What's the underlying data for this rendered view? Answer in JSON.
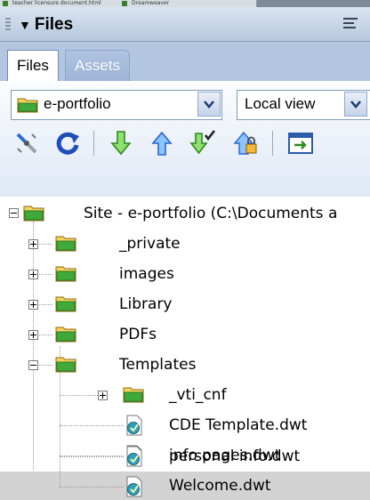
{
  "taskbar": {
    "items": [
      "teacher licensure document.html",
      "Dreamweaver"
    ]
  },
  "panel": {
    "title": "Files",
    "options_icon": "options-menu-icon"
  },
  "tabs": [
    {
      "label": "Files",
      "active": true
    },
    {
      "label": "Assets",
      "active": false
    }
  ],
  "site_select": {
    "value": "e-portfolio",
    "icon": "site-folder-icon"
  },
  "view_select": {
    "value": "Local view"
  },
  "toolbar_icons": [
    "connect-icon",
    "refresh-icon",
    "get-files-icon",
    "put-files-icon",
    "check-out-icon",
    "check-in-icon",
    "expand-panel-icon"
  ],
  "tree": {
    "root_label": "Site - e-portfolio (C:\\Documents a",
    "items": [
      {
        "label": "_private",
        "type": "folder",
        "expander": "plus"
      },
      {
        "label": "images",
        "type": "folder",
        "expander": "plus"
      },
      {
        "label": "Library",
        "type": "folder",
        "expander": "plus"
      },
      {
        "label": "PDFs",
        "type": "folder",
        "expander": "plus"
      },
      {
        "label": "Templates",
        "type": "folder",
        "expander": "minus"
      },
      {
        "label": "_vti_cnf",
        "type": "folder",
        "expander": "plus"
      },
      {
        "label": "CDE Template.dwt",
        "type": "dwt"
      },
      {
        "label": "info pages.dwt",
        "type": "dwt"
      },
      {
        "label": "personal info.dwt",
        "type": "dwt"
      },
      {
        "label": "Welcome.dwt",
        "type": "dwt",
        "selected": true
      }
    ]
  },
  "colors": {
    "folder_fill": "#f6d35b",
    "folder_edge": "#8a6a12",
    "folder_inner": "#3fa93a",
    "selection": "#d3d3d3"
  }
}
